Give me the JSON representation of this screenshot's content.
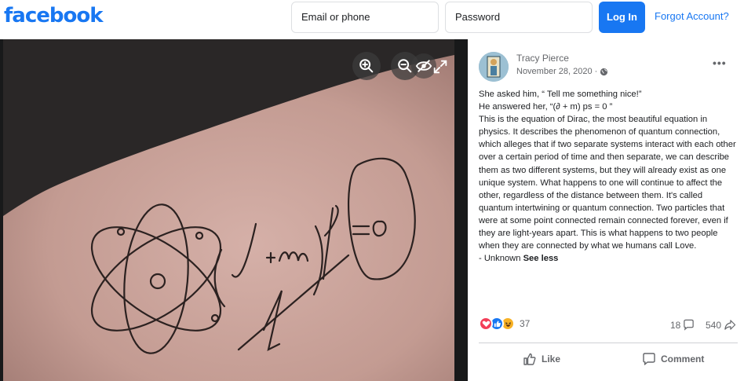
{
  "header": {
    "logo": "facebook",
    "email_placeholder": "Email or phone",
    "password_placeholder": "Password",
    "login_label": "Log In",
    "forgot_label": "Forgot Account?"
  },
  "post": {
    "author": "Tracy Pierce",
    "date": "November 28, 2020 ·",
    "privacy_icon": "globe-icon",
    "lines": [
      "She asked him, “ Tell me something nice!”",
      "He answered her, “(∂ + m) ps = 0 ”",
      "This is the equation of Dirac, the most beautiful equation in physics. It describes the phenomenon of quantum connection, which alleges that if two separate systems interact with each other over a certain period of time and then separate, we can describe them as two different systems, but they will already exist as one unique system. What happens to one will continue to affect the other, regardless of the distance between them. It's called quantum intertwining or quantum connection. Two particles that were at some point connected remain connected forever, even if they are light-years apart. This is what happens to two people when they are connected by what we humans call Love."
    ],
    "signature": "- Unknown",
    "see_less": "See less",
    "reaction_count": "37",
    "comment_count": "18",
    "share_count": "540",
    "like_label": "Like",
    "comment_label": "Comment"
  },
  "colors": {
    "brand": "#1877f2",
    "love": "#f33e58",
    "like": "#1877f2",
    "haha": "#f7b125"
  }
}
